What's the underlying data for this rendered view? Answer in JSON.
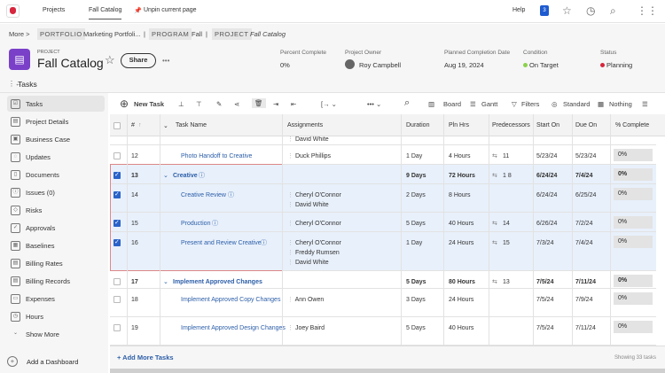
{
  "topbar": {
    "tabs": [
      "Projects",
      "Fall Catalog"
    ],
    "unpin": "Unpin current page",
    "help": "Help",
    "notif_count": "3"
  },
  "breadcrumb": {
    "more": "More",
    "portfolio_tag": "PORTFOLIO",
    "portfolio": "Marketing Portfoli...",
    "program_tag": "PROGRAM",
    "program": "Fall",
    "project_tag": "PROJECT",
    "project": "Fall Catalog"
  },
  "header": {
    "type": "PROJECT",
    "title": "Fall Catalog",
    "share": "Share",
    "more": "•••",
    "meta": [
      {
        "label": "Percent Complete",
        "value": "0%"
      },
      {
        "label": "Project Owner",
        "value": "Roy Campbell"
      },
      {
        "label": "Planned Completion Date",
        "value": "Aug 19, 2024"
      },
      {
        "label": "Condition",
        "value": "On Target"
      },
      {
        "label": "Status",
        "value": "Planning"
      }
    ],
    "condition_color": "#8bd14b",
    "status_color": "#d7263d"
  },
  "tasks_heading": "Tasks",
  "sidebar": {
    "items": [
      "Tasks",
      "Project Details",
      "Business Case",
      "Updates",
      "Documents",
      "Issues (0)",
      "Risks",
      "Approvals",
      "Baselines",
      "Billing Rates",
      "Billing Records",
      "Expenses",
      "Hours",
      "Show More"
    ],
    "add_dashboard": "Add a Dashboard"
  },
  "toolbar": {
    "new_task": "New Task",
    "board": "Board",
    "gantt": "Gantt",
    "filters": "Filters",
    "standard": "Standard",
    "nothing": "Nothing"
  },
  "columns": [
    "#",
    "Task Name",
    "Assignments",
    "Duration",
    "Pln Hrs",
    "Predecessors",
    "Start On",
    "Due On",
    "% Complete"
  ],
  "partial_assignment": "David White",
  "tasks": [
    {
      "num": "12",
      "name": "Photo Handoff to Creative",
      "assign": [
        "Duck Phillips"
      ],
      "dur": "1 Day",
      "hrs": "4 Hours",
      "pred": "11",
      "start": "5/23/24",
      "due": "5/23/24",
      "pct": "0%",
      "sel": false,
      "parent": false,
      "h": 22
    },
    {
      "num": "13",
      "name": "Creative",
      "assign": [],
      "dur": "9 Days",
      "hrs": "72 Hours",
      "pred": "1  8",
      "start": "6/24/24",
      "due": "7/4/24",
      "pct": "0%",
      "sel": true,
      "parent": true,
      "h": 22
    },
    {
      "num": "14",
      "name": "Creative Review",
      "assign": [
        "Cheryl O'Connor",
        "David White"
      ],
      "dur": "2 Days",
      "hrs": "8 Hours",
      "pred": "",
      "start": "6/24/24",
      "due": "6/25/24",
      "pct": "0%",
      "sel": true,
      "parent": false,
      "h": 32
    },
    {
      "num": "15",
      "name": "Production",
      "assign": [
        "Cheryl O'Connor"
      ],
      "dur": "5 Days",
      "hrs": "40 Hours",
      "pred": "14",
      "start": "6/26/24",
      "due": "7/2/24",
      "pct": "0%",
      "sel": true,
      "parent": false,
      "h": 22
    },
    {
      "num": "16",
      "name": "Present and Review Creative",
      "assign": [
        "Cheryl O'Connor",
        "Freddy Rumsen",
        "David White"
      ],
      "dur": "1 Day",
      "hrs": "24 Hours",
      "pred": "15",
      "start": "7/3/24",
      "due": "7/4/24",
      "pct": "0%",
      "sel": true,
      "parent": false,
      "h": 44
    },
    {
      "num": "17",
      "name": "Implement Approved Changes",
      "assign": [],
      "dur": "5 Days",
      "hrs": "80 Hours",
      "pred": "13",
      "start": "7/5/24",
      "due": "7/11/24",
      "pct": "0%",
      "sel": false,
      "parent": true,
      "h": 20
    },
    {
      "num": "18",
      "name": "Implement Approved Copy Changes",
      "assign": [
        "Ann Owen"
      ],
      "dur": "3 Days",
      "hrs": "24 Hours",
      "pred": "",
      "start": "7/5/24",
      "due": "7/9/24",
      "pct": "0%",
      "sel": false,
      "parent": false,
      "h": 32
    },
    {
      "num": "19",
      "name": "Implement Approved Design Changes",
      "assign": [
        "Joey Baird"
      ],
      "dur": "5 Days",
      "hrs": "40 Hours",
      "pred": "",
      "start": "7/5/24",
      "due": "7/11/24",
      "pct": "0%",
      "sel": false,
      "parent": false,
      "h": 32
    }
  ],
  "add_more": "+ Add More Tasks",
  "showing": "Showing 33 tasks"
}
